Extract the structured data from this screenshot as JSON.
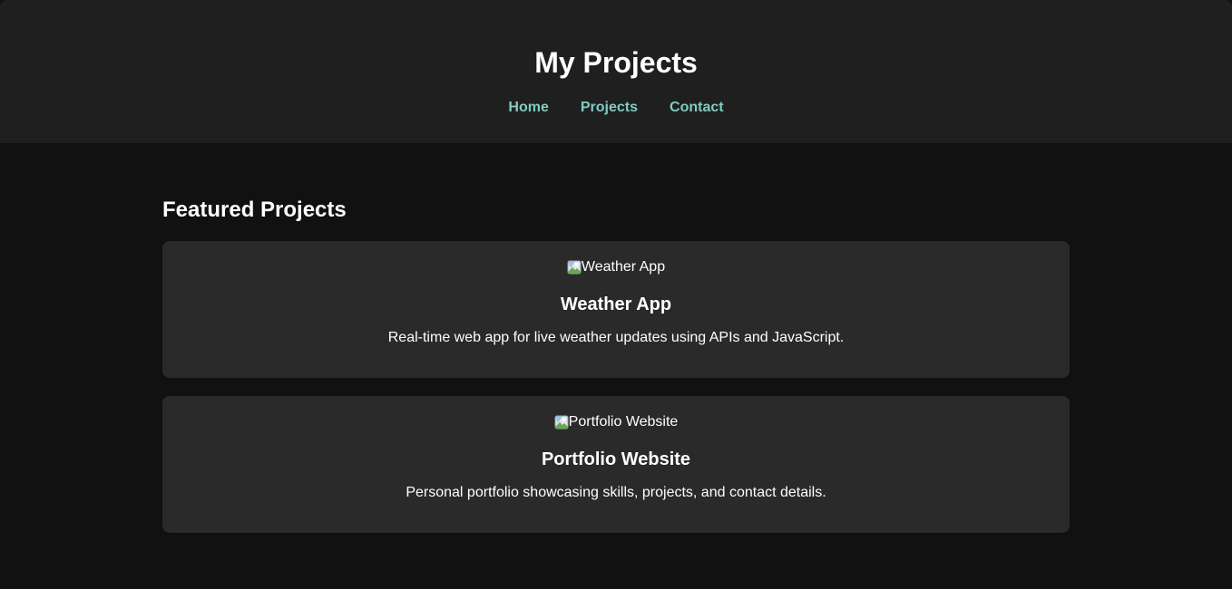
{
  "header": {
    "title": "My Projects",
    "nav": [
      {
        "label": "Home"
      },
      {
        "label": "Projects"
      },
      {
        "label": "Contact"
      }
    ]
  },
  "main": {
    "heading": "Featured Projects",
    "projects": [
      {
        "image_alt": "Weather App",
        "image_icon": "broken-image-icon",
        "title": "Weather App",
        "description": "Real-time web app for live weather updates using APIs and JavaScript."
      },
      {
        "image_alt": "Portfolio Website",
        "image_icon": "broken-image-icon",
        "title": "Portfolio Website",
        "description": "Personal portfolio showcasing skills, projects, and contact details."
      }
    ]
  },
  "colors": {
    "header_bg": "#1f1f1f",
    "page_bg": "#111111",
    "card_bg": "#2a2a2a",
    "nav_link": "#80cbc4",
    "text": "#ffffff"
  }
}
